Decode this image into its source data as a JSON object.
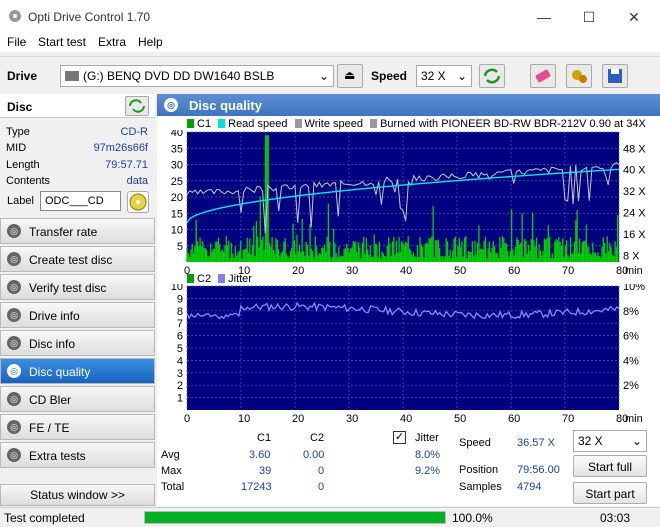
{
  "window": {
    "title": "Opti Drive Control 1.70",
    "min": "—",
    "max": "☐",
    "close": "✕"
  },
  "menu": [
    "File",
    "Start test",
    "Extra",
    "Help"
  ],
  "drivebar": {
    "drive_label": "Drive",
    "drive_value": "(G:)   BENQ DVD DD DW1640 BSLB",
    "speed_label": "Speed",
    "speed_value": "32 X"
  },
  "disc": {
    "header": "Disc",
    "type_k": "Type",
    "type_v": "CD-R",
    "mid_k": "MID",
    "mid_v": "97m26s66f",
    "length_k": "Length",
    "length_v": "79:57.71",
    "contents_k": "Contents",
    "contents_v": "data",
    "label_k": "Label",
    "label_v": "ODC___CD"
  },
  "nav": [
    "Transfer rate",
    "Create test disc",
    "Verify test disc",
    "Drive info",
    "Disc info",
    "Disc quality",
    "CD Bler",
    "FE / TE",
    "Extra tests"
  ],
  "status_window": "Status window >>",
  "main": {
    "title": "Disc quality",
    "legend_c1": "C1",
    "legend_read": "Read speed",
    "legend_write": "Write speed",
    "legend_burn": "Burned with PIONEER BD-RW   BDR-212V 0.90 at 34X",
    "legend_c2": "C2",
    "legend_jitter": "Jitter"
  },
  "chart_data": [
    {
      "type": "bar+line",
      "title": "",
      "x_unit": "min",
      "xlim": [
        0,
        80
      ],
      "ylim": [
        0,
        40
      ],
      "y_right": [
        "48 X",
        "40 X",
        "32 X",
        "24 X",
        "16 X",
        "8 X"
      ],
      "x_ticks": [
        0,
        10,
        20,
        30,
        40,
        50,
        60,
        70,
        80
      ],
      "y_ticks": [
        5,
        10,
        15,
        20,
        25,
        30,
        35,
        40
      ],
      "series": [
        {
          "name": "C1",
          "color": "#00d000"
        },
        {
          "name": "Read speed",
          "color": "#00e0e0"
        },
        {
          "name": "Write speed",
          "color": "#c0c0c0"
        }
      ],
      "avg_c1": 3.6,
      "max_c1": 39
    },
    {
      "type": "bar+line",
      "x_unit": "min",
      "xlim": [
        0,
        80
      ],
      "ylim": [
        0,
        10
      ],
      "y_right": [
        "10%",
        "8%",
        "6%",
        "4%",
        "2%"
      ],
      "x_ticks": [
        0,
        10,
        20,
        30,
        40,
        50,
        60,
        70,
        80
      ],
      "y_ticks": [
        1,
        2,
        3,
        4,
        5,
        6,
        7,
        8,
        9,
        10
      ],
      "series": [
        {
          "name": "C2",
          "color": "#00d000"
        },
        {
          "name": "Jitter",
          "color": "#8080ff"
        }
      ]
    }
  ],
  "stats": {
    "col_c1": "C1",
    "col_c2": "C2",
    "jitter_label": "Jitter",
    "avg_label": "Avg",
    "avg_c1": "3.60",
    "avg_c2": "0.00",
    "avg_jit": "8.0%",
    "max_label": "Max",
    "max_c1": "39",
    "max_c2": "0",
    "max_jit": "9.2%",
    "total_label": "Total",
    "total_c1": "17243",
    "total_c2": "0",
    "speed_label": "Speed",
    "speed_val": "36.57 X",
    "position_label": "Position",
    "position_val": "79:56.00",
    "samples_label": "Samples",
    "samples_val": "4794",
    "speed_select": "32 X",
    "start_full": "Start full",
    "start_part": "Start part"
  },
  "status": {
    "text": "Test completed",
    "percent": "100.0%",
    "progress": 1.0,
    "time": "03:03"
  }
}
